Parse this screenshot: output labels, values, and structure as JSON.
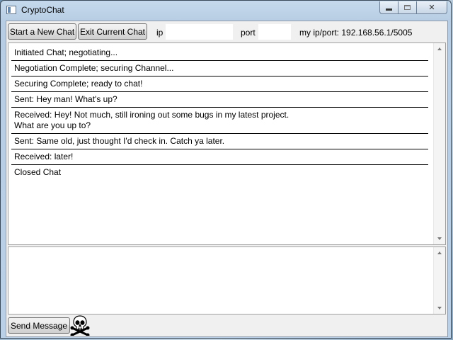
{
  "window": {
    "title": "CryptoChat",
    "minimize_icon": "minimize-icon",
    "maximize_icon": "maximize-icon",
    "close_label": "✕"
  },
  "toolbar": {
    "new_chat_label": "Start a New Chat",
    "exit_chat_label": "Exit Current Chat",
    "ip_label": "ip",
    "ip_value": "",
    "port_label": "port",
    "port_value": "",
    "my_address": "my ip/port: 192.168.56.1/5005"
  },
  "chat_log": {
    "messages": [
      [
        "Initiated Chat; negotiating..."
      ],
      [
        "Negotiation Complete; securing Channel..."
      ],
      [
        "Securing Complete; ready to chat!"
      ],
      [
        "Sent: Hey man! What's up?"
      ],
      [
        "Received: Hey! Not much, still ironing out some bugs in my latest project.",
        "What are you up to?"
      ],
      [
        "Sent: Same old, just thought I'd check in. Catch ya later."
      ],
      [
        "Received: later!"
      ],
      [
        "Closed Chat"
      ]
    ]
  },
  "composer": {
    "value": ""
  },
  "footer": {
    "send_label": "Send Message",
    "logo_icon": "skull-crossbones-icon"
  },
  "colors": {
    "window_frame": "#b9d0e6",
    "client_bg": "#f0f0f0",
    "pane_bg": "#ffffff",
    "separator": "#000000"
  }
}
